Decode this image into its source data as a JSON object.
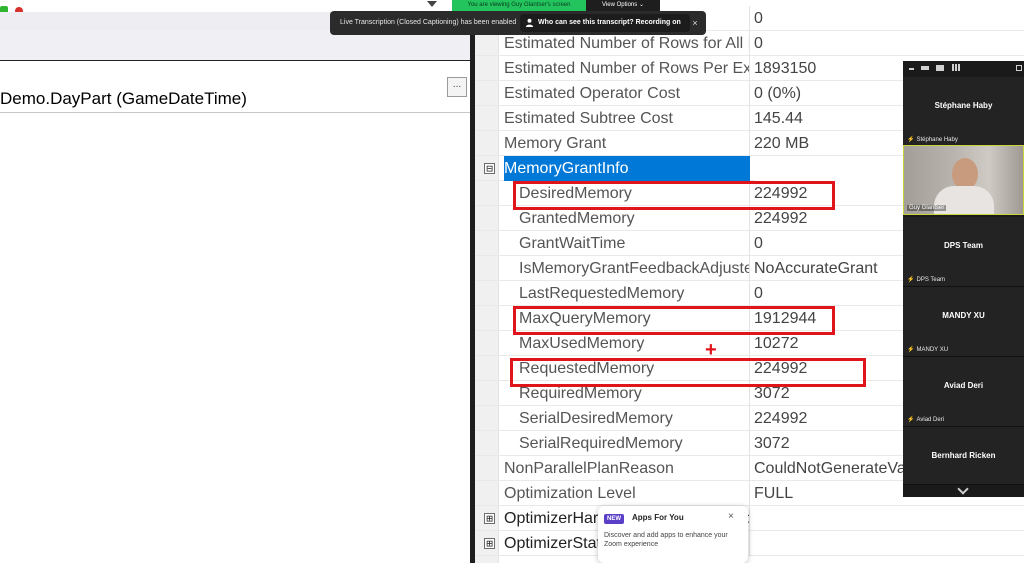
{
  "left_pane": {
    "expression": "Demo.DayPart (GameDateTime)",
    "ellipsis_label": "..."
  },
  "properties": {
    "rows": [
      {
        "name": "",
        "value": "0"
      },
      {
        "name": "Estimated Number of Rows for All Executions",
        "value": "0"
      },
      {
        "name": "Estimated Number of Rows Per Execution",
        "value": "1893150"
      },
      {
        "name": "Estimated Operator Cost",
        "value": "0 (0%)"
      },
      {
        "name": "Estimated Subtree Cost",
        "value": "145.44"
      },
      {
        "name": "Memory Grant",
        "value": "220 MB"
      },
      {
        "name": "MemoryGrantInfo",
        "value": "",
        "expander": "⊟"
      },
      {
        "name": "DesiredMemory",
        "value": "224992"
      },
      {
        "name": "GrantedMemory",
        "value": "224992"
      },
      {
        "name": "GrantWaitTime",
        "value": "0"
      },
      {
        "name": "IsMemoryGrantFeedbackAdjusted",
        "value": "NoAccurateGrant"
      },
      {
        "name": "LastRequestedMemory",
        "value": "0"
      },
      {
        "name": "MaxQueryMemory",
        "value": "1912944"
      },
      {
        "name": "MaxUsedMemory",
        "value": "10272"
      },
      {
        "name": "RequestedMemory",
        "value": "224992"
      },
      {
        "name": "RequiredMemory",
        "value": "3072"
      },
      {
        "name": "SerialDesiredMemory",
        "value": "224992"
      },
      {
        "name": "SerialRequiredMemory",
        "value": "3072"
      },
      {
        "name": "NonParallelPlanReason",
        "value": "CouldNotGenerateValidParallelPlan"
      },
      {
        "name": "Optimization Level",
        "value": "FULL"
      },
      {
        "name": "OptimizerHardwareDependentProperties",
        "value": "",
        "expander": "⊞"
      },
      {
        "name": "OptimizerStatsUsage",
        "value": "",
        "expander": "⊞"
      }
    ],
    "annotation_mark": "+"
  },
  "zoom": {
    "viewing_text": "You are viewing Guy Glantser's screen",
    "view_options": "View Options ⌄",
    "caption_text": "Live Transcription (Closed Captioning) has been enabled",
    "caption_button": "Who can see this transcript? Recording on",
    "caption_close": "×"
  },
  "participants": [
    {
      "name": "Stéphane Haby",
      "label": "Stéphane Haby"
    },
    {
      "name": "",
      "label": "Guy Glantser",
      "video": true
    },
    {
      "name": "DPS Team",
      "label": "DPS Team"
    },
    {
      "name": "MANDY XU",
      "label": "MANDY XU"
    },
    {
      "name": "Aviad Deri",
      "label": "Aviad Deri"
    },
    {
      "name": "Bernhard Ricken",
      "label": ""
    }
  ],
  "apps_popup": {
    "badge": "NEW",
    "title": "Apps For You",
    "close": "×",
    "description": "Discover and add apps to enhance your Zoom experience"
  },
  "colors": {
    "selection": "#0078d7",
    "annotation_red": "#e0151c",
    "viewing_green": "#23c45e"
  }
}
